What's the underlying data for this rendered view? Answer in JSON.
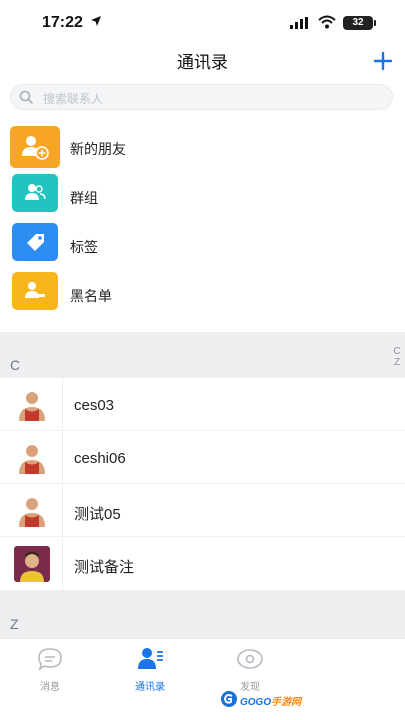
{
  "status_bar": {
    "time": "17:22",
    "battery": "32"
  },
  "header": {
    "title": "通讯录"
  },
  "search": {
    "placeholder": "搜索联系人"
  },
  "menu": [
    {
      "label": "新的朋友",
      "icon": "add-user-icon",
      "color": "#f7a623"
    },
    {
      "label": "群组",
      "icon": "group-icon",
      "color": "#22c4c0"
    },
    {
      "label": "标签",
      "icon": "tag-icon",
      "color": "#2d8df3"
    },
    {
      "label": "黑名单",
      "icon": "blacklist-icon",
      "color": "#f7b71c"
    }
  ],
  "sections": [
    {
      "letter": "C",
      "contacts": [
        {
          "name": "ces03",
          "avatar": "default-avatar-icon"
        },
        {
          "name": "ceshi06",
          "avatar": "default-avatar-icon"
        },
        {
          "name": "测试05",
          "avatar": "default-avatar-icon"
        },
        {
          "name": "测试备注",
          "avatar": "photo-avatar-icon"
        }
      ]
    },
    {
      "letter": "Z",
      "contacts": []
    }
  ],
  "index_bar": [
    "C",
    "Z"
  ],
  "tabs": [
    {
      "label": "消息",
      "icon": "chat-icon",
      "active": false
    },
    {
      "label": "通讯录",
      "icon": "contacts-icon",
      "active": true
    },
    {
      "label": "发现",
      "icon": "discover-icon",
      "active": false
    }
  ],
  "watermark": {
    "text_a": "GOGO",
    "text_b": "手游网"
  },
  "colors": {
    "accent": "#1a73e8",
    "section_bg": "#efeff1"
  }
}
